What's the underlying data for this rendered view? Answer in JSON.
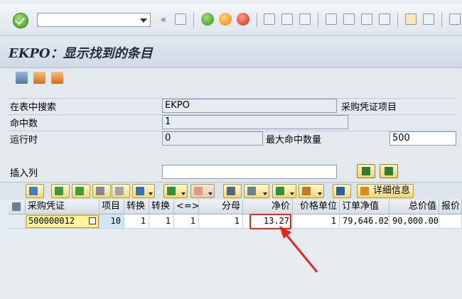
{
  "toolbar": {
    "command_value": "",
    "nav_prev": "«"
  },
  "title": "EKPO：显示找到的条目",
  "form": {
    "search_table_label": "在表中搜索",
    "search_table_value": "EKPO",
    "search_table_desc": "采购凭证项目",
    "hits_label": "命中数",
    "hits_value": "1",
    "runtime_label": "运行时",
    "runtime_value": "0",
    "max_hits_label": "最大命中数量",
    "max_hits_value": "500",
    "insert_column_label": "插入列",
    "insert_column_value": ""
  },
  "alv": {
    "detail_label": "详细信息"
  },
  "table": {
    "headers": [
      "采购凭证",
      "项目",
      "转换",
      "转换",
      "<=>",
      "分母",
      "净价",
      "价格单位",
      "订单净值",
      "总价值",
      "报价"
    ],
    "row": {
      "po": "500000012",
      "item": "10",
      "conv1": "1",
      "conv2": "1",
      "conv3": "1",
      "denom": "1",
      "net_price": "13.27",
      "price_unit": "1",
      "net_value": "79,646.02",
      "total_value": "90,000.00",
      "quote": ""
    }
  },
  "colors": {
    "highlight": "#e8261f",
    "selected_cell": "#fff59d"
  }
}
